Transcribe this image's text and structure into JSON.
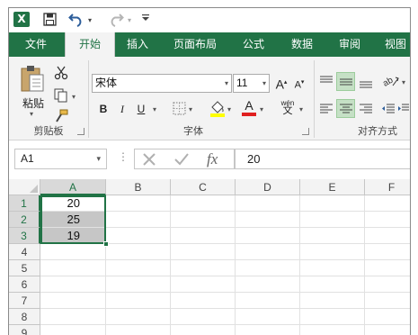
{
  "qat": {
    "app_icon": "X"
  },
  "tabs": [
    {
      "label": "文件",
      "active": false
    },
    {
      "label": "开始",
      "active": true
    },
    {
      "label": "插入",
      "active": false
    },
    {
      "label": "页面布局",
      "active": false
    },
    {
      "label": "公式",
      "active": false
    },
    {
      "label": "数据",
      "active": false
    },
    {
      "label": "审阅",
      "active": false
    },
    {
      "label": "视图",
      "active": false
    }
  ],
  "ribbon": {
    "clipboard": {
      "paste_label": "粘贴",
      "group_label": "剪贴板"
    },
    "font": {
      "font_name": "宋体",
      "font_size": "11",
      "grow_label": "A",
      "shrink_label": "A",
      "bold": "B",
      "italic": "I",
      "underline": "U",
      "phonetic_top": "wén",
      "phonetic_bottom": "文",
      "font_color_label": "A",
      "group_label": "字体"
    },
    "alignment": {
      "group_label": "对齐方式"
    }
  },
  "formula_bar": {
    "name_box": "A1",
    "fx_label": "fx",
    "value": "20"
  },
  "sheet": {
    "columns": [
      "A",
      "B",
      "C",
      "D",
      "E",
      "F"
    ],
    "rows": [
      "1",
      "2",
      "3",
      "4",
      "5",
      "6",
      "7",
      "8",
      "9"
    ],
    "cells": [
      [
        "20",
        "25",
        "19"
      ]
    ]
  }
}
